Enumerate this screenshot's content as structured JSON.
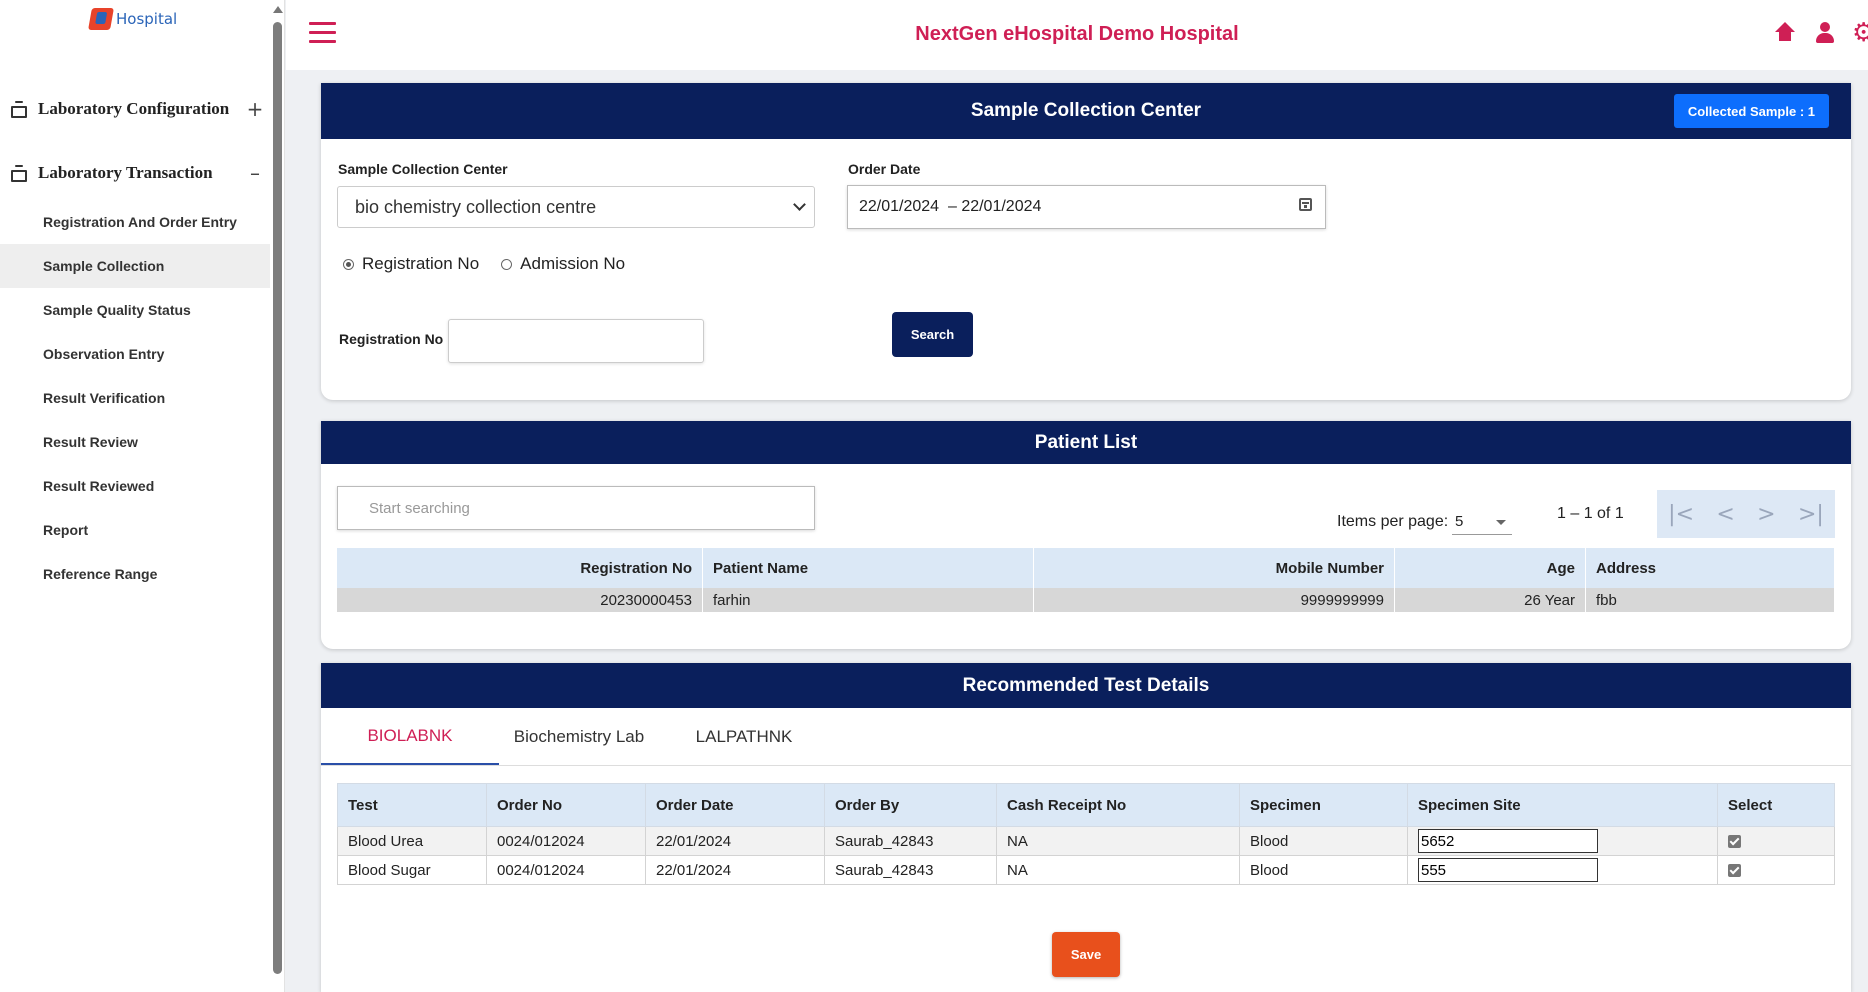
{
  "app": {
    "logo_text": "Hospital",
    "title": "NextGen eHospital Demo Hospital"
  },
  "sidebar": {
    "sections": [
      {
        "label": "Laboratory Configuration",
        "toggle": "+"
      },
      {
        "label": "Laboratory Transaction",
        "toggle": "–"
      }
    ],
    "items": [
      {
        "label": "Registration And Order Entry"
      },
      {
        "label": "Sample Collection"
      },
      {
        "label": "Sample Quality Status"
      },
      {
        "label": "Observation Entry"
      },
      {
        "label": "Result Verification"
      },
      {
        "label": "Result Review"
      },
      {
        "label": "Result Reviewed"
      },
      {
        "label": "Report"
      },
      {
        "label": "Reference Range"
      }
    ]
  },
  "sample_collection": {
    "title": "Sample Collection Center",
    "collected_label": "Collected Sample : 1",
    "center_label": "Sample Collection Center",
    "center_value": "bio chemistry collection centre",
    "order_date_label": "Order Date",
    "order_date_value": "22/01/2024  – 22/01/2024",
    "radio_registration": "Registration No",
    "radio_admission": "Admission No",
    "reg_no_label": "Registration No",
    "reg_no_value": "",
    "search_label": "Search"
  },
  "patient_list": {
    "title": "Patient List",
    "search_placeholder": "Start searching",
    "items_per_page_label": "Items per page:",
    "items_per_page": "5",
    "range": "1 – 1 of 1",
    "pager_first": "|<",
    "pager_prev": "<",
    "pager_next": ">",
    "pager_last": ">|",
    "columns": [
      "Registration No",
      "Patient Name",
      "Mobile Number",
      "Age",
      "Address"
    ],
    "rows": [
      {
        "reg_no": "20230000453",
        "name": "farhin",
        "mobile": "9999999999",
        "age": "26 Year",
        "address": "fbb"
      }
    ]
  },
  "test_details": {
    "title": "Recommended Test Details",
    "tabs": [
      "BIOLABNK",
      "Biochemistry Lab",
      "LALPATHNK"
    ],
    "columns": [
      "Test",
      "Order No",
      "Order Date",
      "Order By",
      "Cash Receipt No",
      "Specimen",
      "Specimen Site",
      "Select"
    ],
    "rows": [
      {
        "test": "Blood Urea",
        "order_no": "0024/012024",
        "order_date": "22/01/2024",
        "order_by": "Saurab_42843",
        "receipt": "NA",
        "specimen": "Blood",
        "site": "5652"
      },
      {
        "test": "Blood Sugar",
        "order_no": "0024/012024",
        "order_date": "22/01/2024",
        "order_by": "Saurab_42843",
        "receipt": "NA",
        "specimen": "Blood",
        "site": "555"
      }
    ],
    "save_label": "Save"
  }
}
